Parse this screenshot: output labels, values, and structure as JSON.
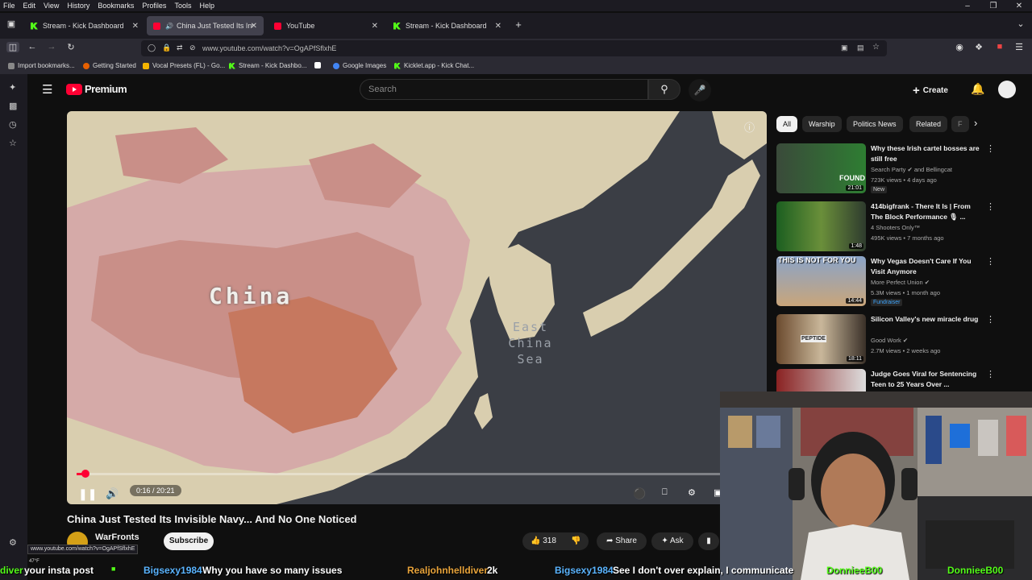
{
  "menubar": {
    "items": [
      "File",
      "Edit",
      "View",
      "History",
      "Bookmarks",
      "Profiles",
      "Tools",
      "Help"
    ]
  },
  "tabs": [
    {
      "label": "Stream - Kick Dashboard",
      "icon": "kick-icon",
      "active": false
    },
    {
      "label": "China Just Tested Its Invisib",
      "icon": "youtube-icon",
      "active": true
    },
    {
      "label": "YouTube",
      "icon": "youtube-icon",
      "active": false
    },
    {
      "label": "Stream - Kick Dashboard",
      "icon": "kick-icon",
      "active": false
    }
  ],
  "navbar": {
    "url": "www.youtube.com/watch?v=OgAPfSflxhE"
  },
  "bookmarks": [
    "Import bookmarks...",
    "Getting Started",
    "Vocal Presets (FL) - Go...",
    "Stream - Kick Dashbo...",
    "Google Images",
    "Kicklet.app - Kick Chat..."
  ],
  "yt": {
    "brand": "Premium",
    "search_placeholder": "Search",
    "create_label": "Create"
  },
  "video": {
    "map_label_country": "China",
    "map_label_sea_1": "East",
    "map_label_sea_2": "China",
    "map_label_sea_3": "Sea",
    "time": "0:16 / 20:21",
    "progress": 0.013,
    "title": "China Just Tested Its Invisible Navy... And No One Noticed",
    "channel": "WarFronts",
    "subscribe_label": "Subscribe",
    "likes": "318",
    "share_label": "Share",
    "ask_label": "Ask"
  },
  "chips": [
    "All",
    "Warship",
    "Politics News",
    "Related",
    "F"
  ],
  "recommendations": [
    {
      "title": "Why these Irish cartel bosses are still free",
      "channel": "Search Party",
      "channel_extra": "and Bellingcat",
      "meta": "723K views • 4 days ago",
      "badge": "New",
      "duration": "21:01",
      "thumb_text": "FOUND"
    },
    {
      "title": "414bigfrank - There It Is | From The Block Performance 🎙 ...",
      "channel": "4 Shooters Only™",
      "channel_extra": "",
      "meta": "495K views • 7 months ago",
      "badge": "",
      "duration": "1:48",
      "thumb_text": ""
    },
    {
      "title": "Why Vegas Doesn't Care If You Visit Anymore",
      "channel": "More Perfect Union",
      "channel_extra": "",
      "meta": "5.3M views • 1 month ago",
      "badge": "Fundraiser",
      "duration": "14:44",
      "thumb_text": "THIS IS NOT FOR YOU"
    },
    {
      "title": "Silicon Valley's new miracle drug",
      "channel": "Good Work",
      "channel_extra": "",
      "meta": "2.7M views • 2 weeks ago",
      "badge": "",
      "duration": "18:11",
      "thumb_text": "PEPTIDE"
    },
    {
      "title": "Judge Goes Viral for Sentencing Teen to 25 Years Over ...",
      "channel": "",
      "channel_extra": "",
      "meta": "",
      "badge": "",
      "duration": "",
      "thumb_text": ""
    }
  ],
  "statusbar_url": "www.youtube.com/watch?v=OgAPfSflxhE",
  "weather": "47°F",
  "overlay": {
    "t1": "diver",
    "t2": "your insta post",
    "t3": "Bigsexy1984",
    "t4": "Why you have so many issues",
    "t5": "Realjohnhelldiver",
    "t6": "2k",
    "t7": "Bigsexy1984",
    "t8": "See I don't over explain, I communicate",
    "t9": "DonnieeB00",
    "t10": "DonnieeB00"
  },
  "colors": {
    "yt_red": "#ff0033",
    "kick_green": "#53fc18",
    "bg": "#0f0f0f"
  }
}
